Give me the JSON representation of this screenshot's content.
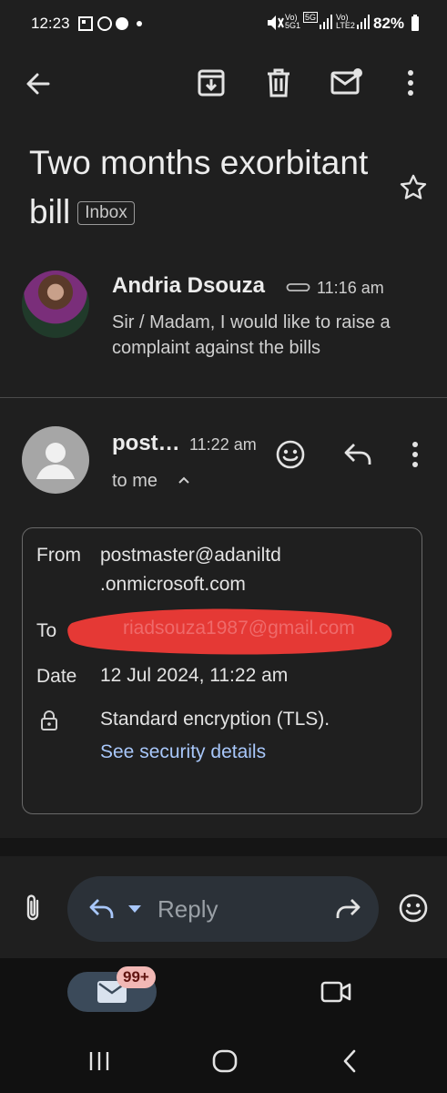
{
  "status_bar": {
    "time": "12:23",
    "volte1": "Vo)\n5G1",
    "net": "5G",
    "volte2": "Vo)\nLTE2",
    "battery": "82%"
  },
  "email": {
    "subject": "Two months exorbitant bill",
    "label": "Inbox"
  },
  "first_message": {
    "sender": "Andria Dsouza",
    "time": "11:16 am",
    "snippet": "Sir / Madam, I would like to raise a complaint against the bills"
  },
  "second_message": {
    "sender": "post…",
    "time": "11:22 am",
    "recipient_line": "to me"
  },
  "details": {
    "from_label": "From",
    "from_line1": "postmaster@adaniltd",
    "from_line2": ".onmicrosoft.com",
    "to_label": "To",
    "to_value": "riadsouza1987@gmail.com",
    "date_label": "Date",
    "date_value": "12 Jul 2024, 11:22 am",
    "encryption_text": "Standard encryption (TLS).",
    "security_link": "See security details"
  },
  "reply_bar": {
    "reply_label": "Reply"
  },
  "bottom_nav": {
    "mail_badge": "99+"
  },
  "colors": {
    "background": "#1f1f1f",
    "link": "#a8c7fa",
    "redaction": "#e53935",
    "badge_bg": "#f2b8b5"
  },
  "icons": [
    "back-arrow-icon",
    "archive-icon",
    "delete-icon",
    "mark-unread-icon",
    "more-vert-icon",
    "star-icon",
    "attachment-icon",
    "emoji-icon",
    "reply-icon",
    "lock-icon",
    "forward-icon",
    "mail-icon",
    "video-icon",
    "recents-icon",
    "home-icon",
    "nav-back-icon"
  ]
}
